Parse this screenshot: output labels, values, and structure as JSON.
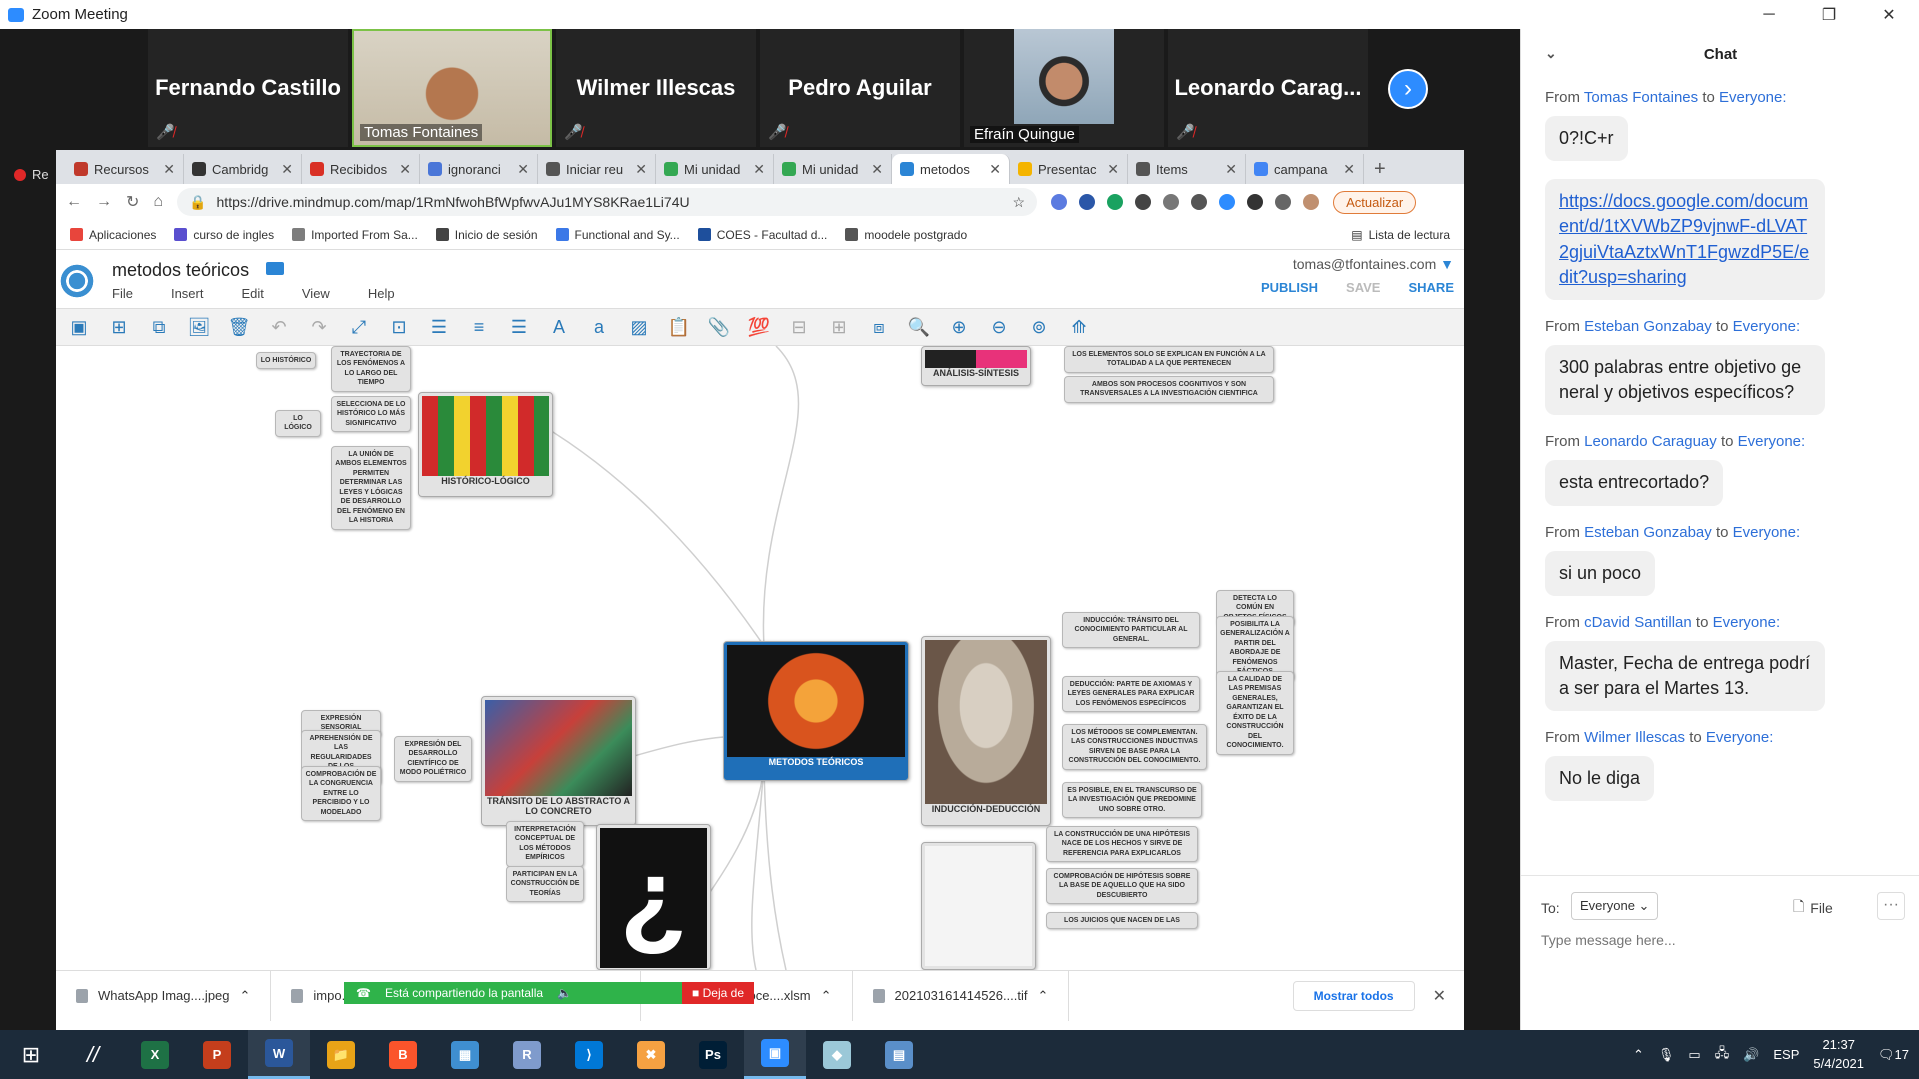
{
  "window": {
    "title": "Zoom Meeting",
    "min": "─",
    "max": "❐",
    "close": "✕"
  },
  "participants": [
    {
      "name": "Fernando Castillo",
      "video": false
    },
    {
      "name": "Tomas Fontaines",
      "video": true
    },
    {
      "name": "Wilmer Illescas",
      "video": false
    },
    {
      "name": "Pedro Aguilar",
      "video": false
    },
    {
      "name": "Efraín Quingue",
      "video": true
    },
    {
      "name": "Leonardo Carag...",
      "video": false
    }
  ],
  "recording_label": "Re",
  "browser": {
    "tabs": [
      {
        "label": "Recursos",
        "color": "#c0392b"
      },
      {
        "label": "Cambridg",
        "color": "#333333"
      },
      {
        "label": "Recibidos",
        "color": "#d93025"
      },
      {
        "label": "ignoranci",
        "color": "#4a76d8"
      },
      {
        "label": "Iniciar reu",
        "color": "#555555"
      },
      {
        "label": "Mi unidad",
        "color": "#34a853"
      },
      {
        "label": "Mi unidad",
        "color": "#34a853"
      },
      {
        "label": "metodos",
        "color": "#2b85d5",
        "active": true
      },
      {
        "label": "Presentac",
        "color": "#f4b400"
      },
      {
        "label": "Items",
        "color": "#555555"
      },
      {
        "label": "campana",
        "color": "#4285f4"
      }
    ],
    "new_tab": "+",
    "url": "https://drive.mindmup.com/map/1RmNfwohBfWpfwvAJu1MYS8KRae1Li74U",
    "update_label": "Actualizar",
    "bookmarks": [
      {
        "label": "Aplicaciones",
        "color": "#e8453c"
      },
      {
        "label": "curso de ingles",
        "color": "#5a4fcf"
      },
      {
        "label": "Imported From Sa...",
        "color": "#7d7d7d"
      },
      {
        "label": "Inicio de sesión",
        "color": "#444444"
      },
      {
        "label": "Functional and Sy...",
        "color": "#3b78e7"
      },
      {
        "label": "COES - Facultad d...",
        "color": "#1e4f9c"
      },
      {
        "label": "moodele postgrado",
        "color": "#555555"
      }
    ],
    "reading_list": "Lista de lectura"
  },
  "mindmup": {
    "title": "metodos teóricos",
    "menu": [
      "File",
      "Insert",
      "Edit",
      "View",
      "Help"
    ],
    "user": "tomas@tfontaines.com",
    "publish": "PUBLISH",
    "save": "SAVE",
    "share": "SHARE"
  },
  "nodes": {
    "center": "METODOS TEÓRICOS",
    "historico": "HISTÓRICO-LÓGICO",
    "transito": "TRÁNSITO DE LO ABSTRACTO A LO CONCRETO",
    "induccion": "INDUCCIÓN-DEDUCCIÓN",
    "analisis": "ANÁLISIS-SÍNTESIS",
    "t1": "TRAYECTORIA DE LOS FENÓMENOS A LO LARGO DEL TIEMPO",
    "t2": "LO HISTÓRICO",
    "t3": "SELECCIONA DE LO HISTÓRICO LO MÁS SIGNIFICATIVO",
    "t4": "LO LÓGICO",
    "t5": "LA UNIÓN DE AMBOS ELEMENTOS PERMITEN DETERMINAR LAS LEYES Y LÓGICAS DE DESARROLLO DEL FENÓMENO EN LA HISTORIA",
    "a1": "LOS ELEMENTOS SOLO SE EXPLICAN EN FUNCIÓN A LA TOTALIDAD A LA QUE PERTENECEN",
    "a2": "AMBOS SON PROCESOS COGNITIVOS Y SON TRANSVERSALES A LA INVESTIGACIÓN CIENTIFICA",
    "i1": "INDUCCIÓN: TRÁNSITO DEL CONOCIMIENTO PARTICULAR AL GENERAL.",
    "i2": "DETECTA LO COMÚN EN OBJETOS FÍSICOS",
    "i3": "POSIBILITA LA GENERALIZACIÓN A PARTIR DEL ABORDAJE DE FENÓMENOS FÁCTICOS",
    "i4": "DEDUCCIÓN: PARTE DE AXIOMAS Y LEYES GENERALES PARA EXPLICAR LOS FENÓMENOS ESPECÍFICOS",
    "i5": "LA CALIDAD DE LAS PREMISAS GENERALES, GARANTIZAN EL ÉXITO DE LA CONSTRUCCIÓN DEL CONOCIMIENTO.",
    "i6": "LOS MÉTODOS SE COMPLEMENTAN. LAS CONSTRUCCIONES INDUCTIVAS SIRVEN DE BASE PARA LA CONSTRUCCIÓN DEL CONOCIMIENTO.",
    "i7": "ES POSIBLE, EN EL TRANSCURSO DE LA INVESTIGACIÓN QUE PREDOMINE UNO SOBRE OTRO.",
    "x1": "EXPRESIÓN SENSORIAL",
    "x2": "APREHENSIÓN DE LAS REGULARIDADES DE LOS FENÓMENOS",
    "x3": "COMPROBACIÓN DE LA CONGRUENCIA ENTRE LO PERCIBIDO Y LO MODELADO",
    "x4": "EXPRESIÓN DEL DESARROLLO CIENTÍFICO DE MODO POLIÉTRICO",
    "m1": "INTERPRETACIÓN CONCEPTUAL DE LOS MÉTODOS EMPÍRICOS",
    "m2": "PARTICIPAN EN LA CONSTRUCCIÓN DE TEORÍAS",
    "h1": "LA CONSTRUCCIÓN DE UNA HIPÓTESIS NACE DE LOS HECHOS Y SIRVE DE REFERENCIA PARA EXPLICARLOS",
    "h2": "COMPROBACIÓN DE HIPÓTESIS SOBRE LA BASE DE AQUELLO QUE HA SIDO DESCUBIERTO",
    "h3": "LOS JUICIOS QUE NACEN DE LAS"
  },
  "downloads": [
    {
      "name": "WhatsApp Imag....jpeg"
    },
    {
      "name": "impo..."
    },
    {
      "name": "Data_preproce....xlsm"
    },
    {
      "name": "202103161414526....tif"
    }
  ],
  "sharing": {
    "label": "Está compartiendo la pantalla",
    "stop": "Deja de"
  },
  "show_all": "Mostrar todos",
  "chat": {
    "title": "Chat",
    "from_word": "From",
    "to_word": "to",
    "messages": [
      {
        "from": "Tomas Fontaines",
        "to": "Everyone:",
        "text": "0?!C+r"
      },
      {
        "from": "Tomas Fontaines",
        "to": "Everyone:",
        "link": "https://docs.google.com/document/d/1tXVWbZP9vjnwF-dLVAT2gjuiVtaAztxWnT1FgwzdP5E/edit?usp=sharing",
        "hide_from": true
      },
      {
        "from": "Esteban Gonzabay",
        "to": "Everyone:",
        "text": "300 palabras entre objetivo general y objetivos específicos?"
      },
      {
        "from": "Leonardo Caraguay",
        "to": "Everyone:",
        "text": "esta entrecortado?"
      },
      {
        "from": "Esteban Gonzabay",
        "to": "Everyone:",
        "text": "si un poco"
      },
      {
        "from": "cDavid Santillan",
        "to": "Everyone:",
        "text": "Master, Fecha de entrega podría ser para el Martes 13."
      },
      {
        "from": "Wilmer Illescas",
        "to": "Everyone:",
        "text": "No le diga"
      }
    ],
    "to_label": "To:",
    "recipient": "Everyone",
    "file_label": "File",
    "more": "···",
    "placeholder": "Type message here..."
  },
  "taskbar": {
    "apps": [
      {
        "label": "X",
        "color": "#1e7145"
      },
      {
        "label": "P",
        "color": "#c43e1c"
      },
      {
        "label": "W",
        "color": "#2b579a",
        "on": true
      },
      {
        "label": "📁",
        "color": "#e8a317"
      },
      {
        "label": "B",
        "color": "#fb542b"
      },
      {
        "label": "▦",
        "color": "#3f8fd1"
      },
      {
        "label": "R",
        "color": "#7f9bcc"
      },
      {
        "label": "⟩",
        "color": "#0078d7"
      },
      {
        "label": "✖",
        "color": "#f5a142"
      },
      {
        "label": "Ps",
        "color": "#001e36"
      },
      {
        "label": "▣",
        "color": "#2d8cff",
        "on": true
      },
      {
        "label": "◆",
        "color": "#9bc8d8"
      },
      {
        "label": "▤",
        "color": "#5a8fc9"
      }
    ],
    "lang": "ESP",
    "time": "21:37",
    "date": "5/4/2021",
    "notif": "17"
  }
}
